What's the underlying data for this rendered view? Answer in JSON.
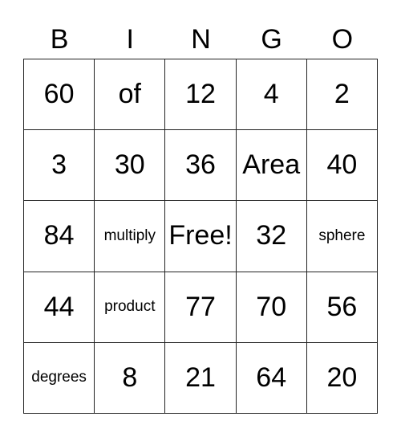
{
  "header": [
    "B",
    "I",
    "N",
    "G",
    "O"
  ],
  "cells": [
    [
      "60",
      "of",
      "12",
      "4",
      "2"
    ],
    [
      "3",
      "30",
      "36",
      "Area",
      "40"
    ],
    [
      "84",
      "multiply",
      "Free!",
      "32",
      "sphere"
    ],
    [
      "44",
      "product",
      "77",
      "70",
      "56"
    ],
    [
      "degrees",
      "8",
      "21",
      "64",
      "20"
    ]
  ]
}
